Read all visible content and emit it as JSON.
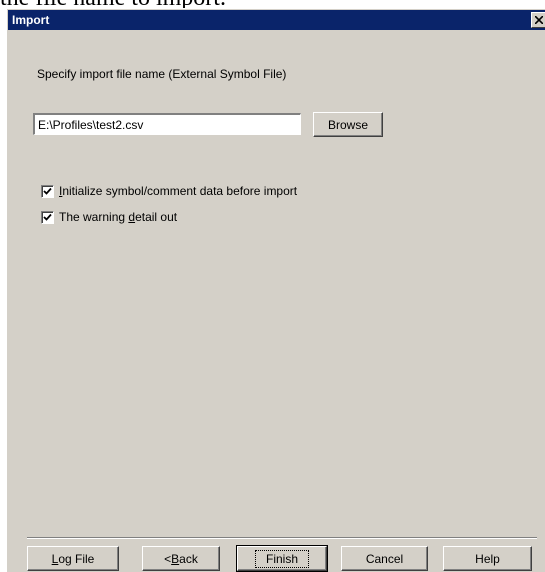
{
  "caption_text": "the file name to import.",
  "window": {
    "title": "Import"
  },
  "prompt": "Specify import file name (External Symbol File)",
  "file_input": {
    "value": "E:\\Profiles\\test2.csv"
  },
  "browse_label": "Browse",
  "options": [
    {
      "label_pre": "",
      "label_key": "I",
      "label_post": "nitialize symbol/comment data before import",
      "checked": true
    },
    {
      "label_pre": "The warning ",
      "label_key": "d",
      "label_post": "etail out",
      "checked": true
    }
  ],
  "buttons": {
    "log_pre": "",
    "log_key": "L",
    "log_post": "og File",
    "back_pre": "<",
    "back_key": "B",
    "back_post": "ack",
    "finish": "Finish",
    "cancel": "Cancel",
    "help": "Help"
  },
  "icons": {
    "close": "close-icon",
    "check": "checkmark-icon"
  }
}
